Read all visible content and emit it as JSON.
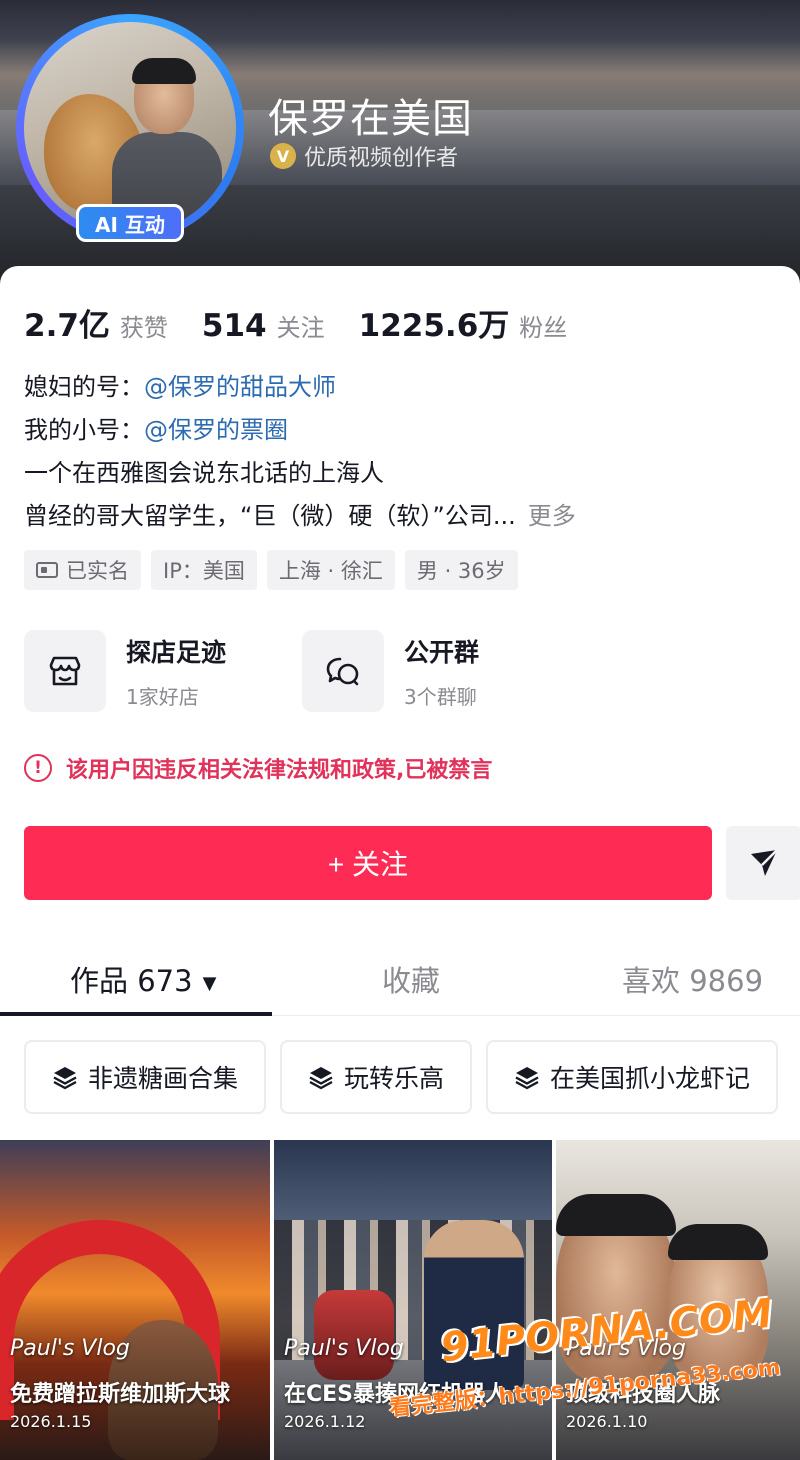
{
  "profile": {
    "name": "保罗在美国",
    "creator_label": "优质视频创作者",
    "ai_badge": "AI 互动"
  },
  "stats": [
    {
      "value": "2.7亿",
      "label": "获赞"
    },
    {
      "value": "514",
      "label": "关注"
    },
    {
      "value": "1225.6万",
      "label": "粉丝"
    }
  ],
  "bio": {
    "line1_prefix": "媳妇的号：",
    "line1_mention": "@保罗的甜品大师",
    "line2_prefix": "我的小号：",
    "line2_mention": "@保罗的票圈",
    "line3": "一个在西雅图会说东北话的上海人",
    "line4": "曾经的哥大留学生，“巨（微）硬（软）”公司...",
    "more": "更多"
  },
  "tags": [
    {
      "label": "已实名",
      "icon": "id-card-icon"
    },
    {
      "label": "IP：美国"
    },
    {
      "label": "上海 · 徐汇"
    },
    {
      "label": "男 · 36岁"
    }
  ],
  "features": [
    {
      "title": "探店足迹",
      "sub": "1家好店",
      "icon": "store-icon"
    },
    {
      "title": "公开群",
      "sub": "3个群聊",
      "icon": "group-chat-icon"
    }
  ],
  "warning": {
    "text": "该用户因违反相关法律法规和政策,已被禁言",
    "icon": "alert-circle-icon",
    "color": "#e0325b"
  },
  "follow_button": {
    "label": "+ 关注",
    "color": "#fe2c55"
  },
  "tabs": [
    {
      "label": "作品 673",
      "active": true
    },
    {
      "label": "收藏",
      "active": false
    },
    {
      "label": "喜欢 9869",
      "active": false
    }
  ],
  "collections": [
    {
      "label": "非遗糖画合集"
    },
    {
      "label": "玩转乐高"
    },
    {
      "label": "在美国抓小龙虾记"
    }
  ],
  "videos": [
    {
      "vlog": "Paul's Vlog",
      "title": "免费蹭拉斯维加斯大球",
      "date": "2026.1.15"
    },
    {
      "vlog": "Paul's Vlog",
      "title": "在CES暴揍网红机器人",
      "date": "2026.1.12"
    },
    {
      "vlog": "Paul's Vlog",
      "title": "顶级科技圈人脉",
      "date": "2026.1.10"
    }
  ],
  "watermark": {
    "brand": "91PORNA.COM",
    "url_line": "看完整版：https://91porna33.com"
  }
}
